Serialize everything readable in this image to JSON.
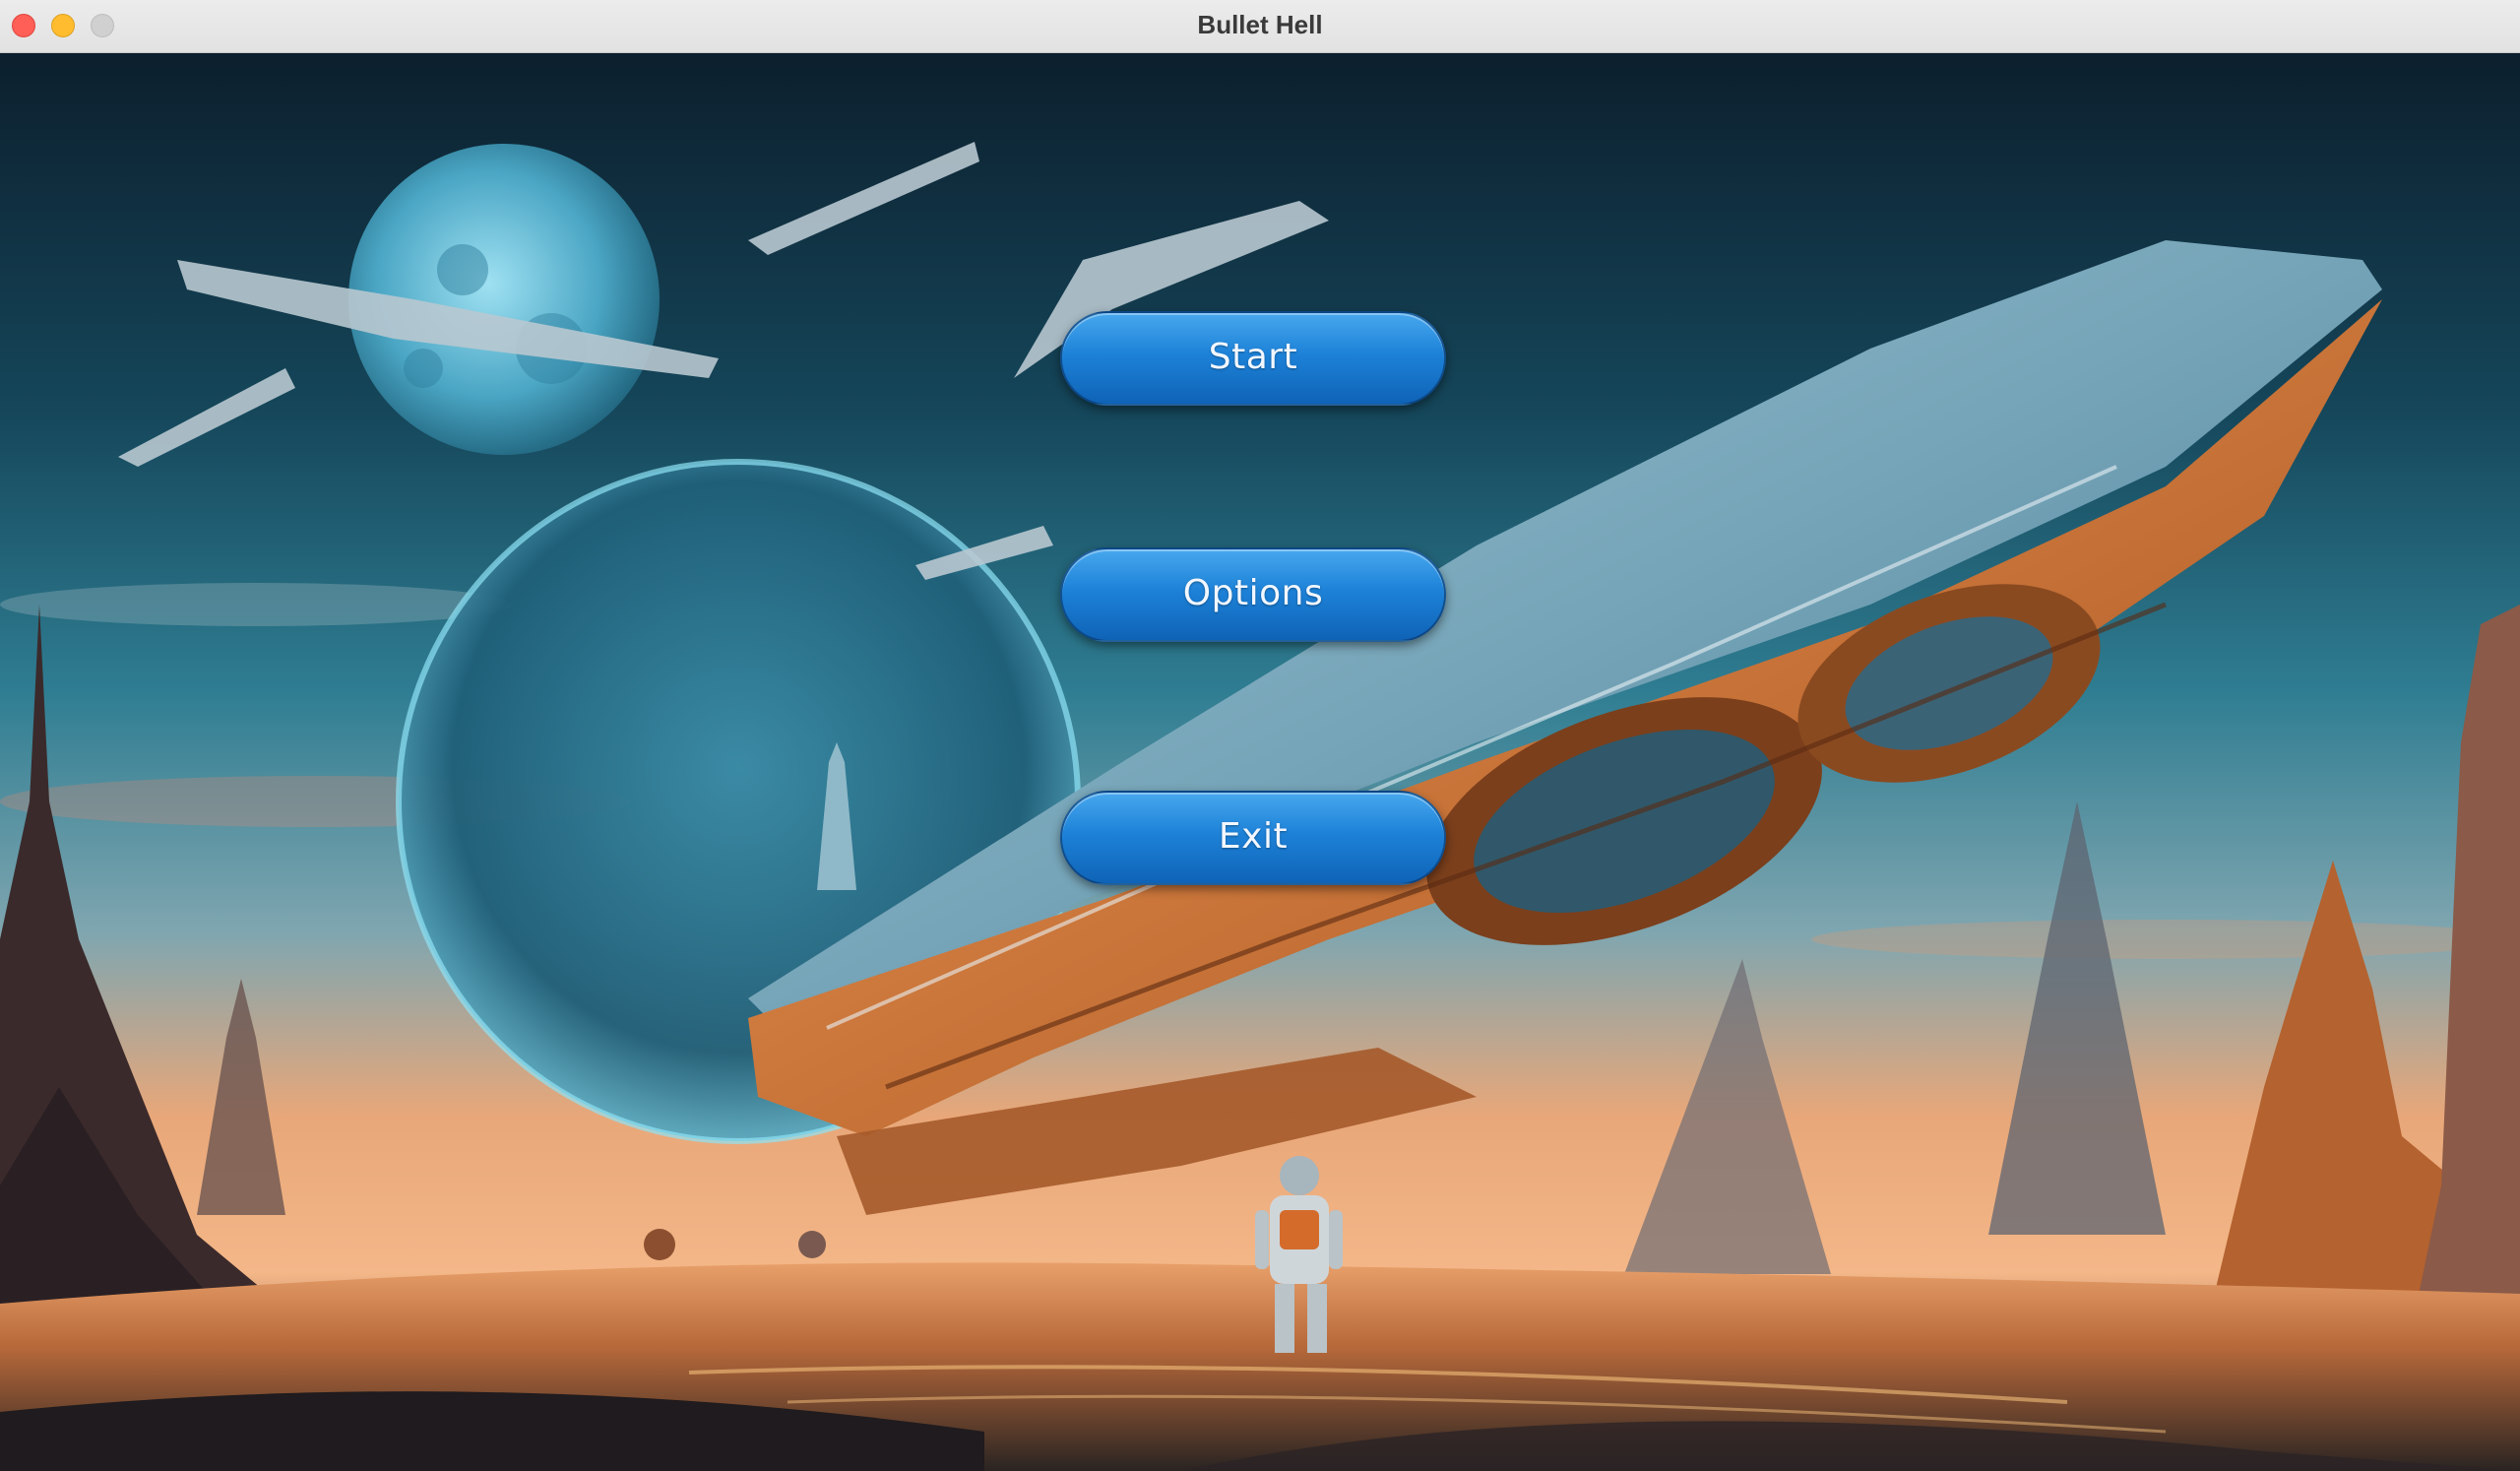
{
  "window": {
    "title": "Bullet Hell"
  },
  "menu": {
    "start_label": "Start",
    "options_label": "Options",
    "exit_label": "Exit"
  },
  "colors": {
    "button_top": "#48a8ee",
    "button_bottom": "#0f63b6",
    "sky_top": "#0d2535",
    "sky_horizon": "#f0a06a",
    "ship_hull": "#d9742f"
  }
}
